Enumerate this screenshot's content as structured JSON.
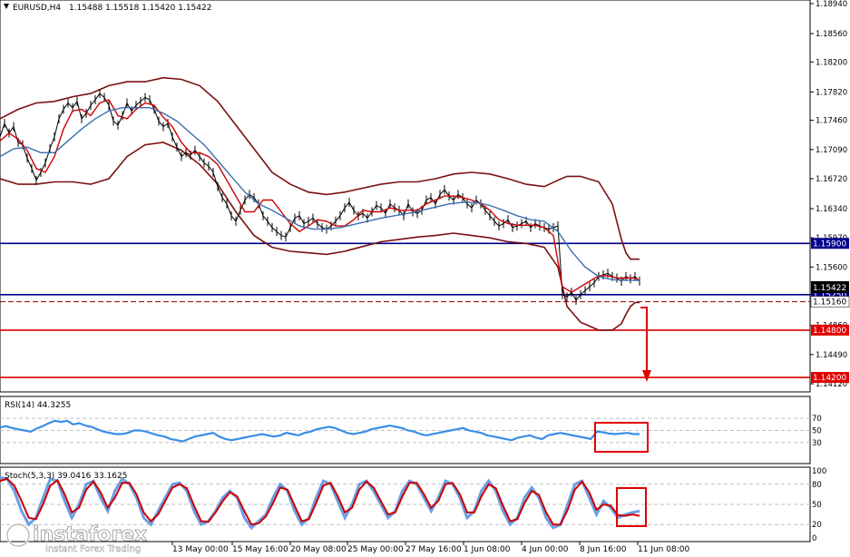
{
  "header": {
    "symbol": "EURUSD,H4",
    "ohlc": "1.15488 1.15518 1.15420 1.15422"
  },
  "rsi": {
    "label": "RSI(14) 44.3255",
    "ticks": [
      "70",
      "50",
      "30"
    ]
  },
  "stoch": {
    "label": "Stoch(5,3,3) 39.0416 33.1625",
    "ticks": [
      "100",
      "80",
      "50",
      "20",
      "0"
    ]
  },
  "logo": {
    "brand": "instaforex",
    "tagline": "Instant Forex Trading"
  },
  "chart_data": {
    "type": "line",
    "title": "EURUSD,H4",
    "y_ticks": [
      "1.18940",
      "1.18560",
      "1.18200",
      "1.17820",
      "1.17460",
      "1.17090",
      "1.16720",
      "1.16340",
      "1.15970",
      "1.15600",
      "1.15250",
      "1.14860",
      "1.14490",
      "1.14120"
    ],
    "x_labels": [
      "13 May 00:00",
      "15 May 16:00",
      "20 May 08:00",
      "25 May 00:00",
      "27 May 16:00",
      "1 Jun 08:00",
      "4 Jun 00:00",
      "8 Jun 16:00",
      "11 Jun 08:00"
    ],
    "current_price": "1.15422",
    "levels": [
      {
        "value": 1.159,
        "label": "1.15900",
        "color": "#00008b"
      },
      {
        "value": 1.1525,
        "label": "1.15250",
        "color": "#00008b"
      },
      {
        "value": 1.1516,
        "label": "1.15160",
        "color": "#8b0000"
      },
      {
        "value": 1.148,
        "label": "1.14800",
        "color": "#e00000"
      },
      {
        "value": 1.142,
        "label": "1.14200",
        "color": "#e00000"
      }
    ],
    "series": [
      {
        "name": "Price",
        "color": "#000000",
        "x": [
          0,
          5,
          10,
          15,
          20,
          25,
          30,
          35,
          40,
          45,
          50,
          55,
          60,
          65,
          70,
          75,
          80,
          85,
          90,
          95,
          100,
          105,
          110,
          115,
          120,
          125,
          130,
          135,
          140,
          145,
          150,
          155,
          160,
          165,
          170,
          175,
          180,
          185,
          190,
          195,
          200,
          205,
          210,
          215,
          220,
          225,
          230,
          235,
          240,
          245,
          250,
          255,
          260,
          265,
          270,
          275,
          280,
          285,
          290,
          295,
          300,
          305,
          310,
          315,
          320,
          325,
          330,
          335,
          340,
          345,
          350,
          355,
          360,
          365,
          370,
          375,
          380,
          385,
          390,
          395,
          400,
          405,
          410,
          415,
          420,
          425,
          430,
          435,
          440,
          445,
          450,
          455,
          460,
          465,
          470,
          475,
          480,
          485,
          490,
          495,
          500,
          505,
          510,
          515,
          520,
          525,
          530,
          535,
          540,
          545,
          550,
          555,
          560,
          565,
          570,
          575,
          580,
          585,
          590,
          595,
          600,
          605,
          610,
          615,
          620,
          625,
          630,
          635,
          640,
          645,
          650,
          655,
          660,
          665,
          670,
          675,
          680,
          685,
          690,
          695,
          700,
          705
        ],
        "values": [
          1.1725,
          1.1742,
          1.173,
          1.1738,
          1.1718,
          1.1715,
          1.1698,
          1.1685,
          1.167,
          1.168,
          1.1692,
          1.171,
          1.1725,
          1.1748,
          1.176,
          1.1768,
          1.1762,
          1.177,
          1.1748,
          1.1755,
          1.1765,
          1.1772,
          1.178,
          1.1775,
          1.1765,
          1.1745,
          1.174,
          1.1752,
          1.1768,
          1.1758,
          1.1765,
          1.177,
          1.1775,
          1.1772,
          1.176,
          1.1745,
          1.1738,
          1.1742,
          1.1725,
          1.1712,
          1.17,
          1.1705,
          1.1702,
          1.1708,
          1.17,
          1.1692,
          1.1688,
          1.168,
          1.1662,
          1.1648,
          1.164,
          1.1625,
          1.1618,
          1.1632,
          1.1645,
          1.1652,
          1.1648,
          1.164,
          1.1625,
          1.1618,
          1.161,
          1.1605,
          1.16,
          1.1598,
          1.161,
          1.1622,
          1.1625,
          1.1615,
          1.1618,
          1.1622,
          1.1615,
          1.161,
          1.1608,
          1.1612,
          1.1618,
          1.1625,
          1.1635,
          1.1642,
          1.1632,
          1.1625,
          1.1628,
          1.1622,
          1.163,
          1.1638,
          1.1635,
          1.1628,
          1.164,
          1.1635,
          1.1632,
          1.1625,
          1.164,
          1.163,
          1.1628,
          1.1632,
          1.1645,
          1.1648,
          1.164,
          1.1652,
          1.1658,
          1.165,
          1.1645,
          1.1652,
          1.1648,
          1.164,
          1.1635,
          1.1645,
          1.164,
          1.1632,
          1.1625,
          1.1618,
          1.1612,
          1.1615,
          1.162,
          1.161,
          1.1612,
          1.1615,
          1.1618,
          1.161,
          1.1615,
          1.1612,
          1.161,
          1.1608,
          1.161,
          1.1612,
          1.1525,
          1.1522,
          1.1528,
          1.1518,
          1.1525,
          1.153,
          1.1535,
          1.154,
          1.1548,
          1.155,
          1.1552,
          1.1548,
          1.1546,
          1.1542,
          1.1548,
          1.1545,
          1.1548,
          1.15422
        ]
      },
      {
        "name": "MA fast",
        "color": "#cc0000",
        "x": [
          0,
          10,
          20,
          30,
          40,
          50,
          60,
          70,
          80,
          90,
          100,
          110,
          120,
          130,
          140,
          150,
          160,
          170,
          180,
          190,
          200,
          210,
          220,
          230,
          240,
          250,
          260,
          270,
          280,
          290,
          300,
          310,
          320,
          330,
          340,
          350,
          360,
          370,
          380,
          390,
          400,
          410,
          420,
          430,
          440,
          450,
          460,
          470,
          480,
          490,
          500,
          510,
          520,
          530,
          540,
          550,
          560,
          570,
          580,
          590,
          600,
          610,
          620,
          630,
          640,
          650,
          660,
          670,
          680,
          690,
          700,
          705
        ],
        "values": [
          1.172,
          1.173,
          1.1722,
          1.1708,
          1.1685,
          1.168,
          1.17,
          1.1735,
          1.1758,
          1.176,
          1.1752,
          1.1768,
          1.1772,
          1.1752,
          1.1748,
          1.176,
          1.1768,
          1.1765,
          1.175,
          1.1738,
          1.1718,
          1.1705,
          1.1705,
          1.17,
          1.169,
          1.167,
          1.165,
          1.163,
          1.163,
          1.1645,
          1.1645,
          1.163,
          1.1615,
          1.1605,
          1.1612,
          1.162,
          1.1618,
          1.1612,
          1.1612,
          1.162,
          1.1632,
          1.163,
          1.163,
          1.1635,
          1.1632,
          1.1632,
          1.1632,
          1.164,
          1.1645,
          1.165,
          1.165,
          1.1648,
          1.1645,
          1.164,
          1.1632,
          1.162,
          1.1615,
          1.1613,
          1.1613,
          1.1613,
          1.161,
          1.16,
          1.1535,
          1.1528,
          1.1535,
          1.1542,
          1.1549,
          1.1549,
          1.1546,
          1.1546,
          1.1546,
          1.1543
        ]
      },
      {
        "name": "MA slow",
        "color": "#3a6fb0",
        "x": [
          0,
          15,
          30,
          45,
          60,
          75,
          90,
          105,
          120,
          135,
          150,
          165,
          180,
          195,
          210,
          225,
          240,
          255,
          270,
          285,
          300,
          315,
          330,
          345,
          360,
          375,
          390,
          405,
          420,
          435,
          450,
          465,
          480,
          495,
          510,
          525,
          540,
          555,
          570,
          585,
          600,
          615,
          630,
          645,
          660,
          675,
          690,
          705
        ],
        "values": [
          1.17,
          1.171,
          1.1712,
          1.1705,
          1.1705,
          1.172,
          1.1735,
          1.1748,
          1.1758,
          1.1762,
          1.1762,
          1.1762,
          1.1755,
          1.1745,
          1.173,
          1.1715,
          1.1695,
          1.1675,
          1.1655,
          1.164,
          1.1632,
          1.1622,
          1.1612,
          1.1608,
          1.1608,
          1.161,
          1.1614,
          1.1618,
          1.1622,
          1.1625,
          1.1628,
          1.1632,
          1.1636,
          1.164,
          1.1642,
          1.1642,
          1.1638,
          1.1632,
          1.1625,
          1.162,
          1.1618,
          1.1605,
          1.158,
          1.156,
          1.1548,
          1.1544,
          1.1543,
          1.1543
        ]
      },
      {
        "name": "BB upper",
        "color": "#7a1010",
        "x": [
          0,
          20,
          40,
          60,
          80,
          100,
          120,
          140,
          160,
          180,
          200,
          220,
          240,
          260,
          280,
          300,
          320,
          340,
          360,
          380,
          400,
          420,
          440,
          460,
          480,
          500,
          520,
          540,
          560,
          580,
          600,
          615,
          625,
          640,
          660,
          675,
          685,
          690,
          695,
          700,
          705
        ],
        "values": [
          1.1748,
          1.176,
          1.1768,
          1.177,
          1.1776,
          1.178,
          1.179,
          1.1795,
          1.1795,
          1.18,
          1.1798,
          1.179,
          1.177,
          1.174,
          1.171,
          1.168,
          1.1665,
          1.1655,
          1.1652,
          1.1655,
          1.166,
          1.1665,
          1.1668,
          1.1668,
          1.1672,
          1.1678,
          1.168,
          1.1678,
          1.1672,
          1.1665,
          1.1662,
          1.167,
          1.1675,
          1.1675,
          1.1668,
          1.164,
          1.1595,
          1.1578,
          1.157,
          1.157,
          1.157
        ]
      },
      {
        "name": "BB lower",
        "color": "#7a1010",
        "x": [
          0,
          20,
          40,
          60,
          80,
          100,
          120,
          140,
          160,
          180,
          200,
          220,
          240,
          260,
          280,
          300,
          320,
          340,
          360,
          380,
          400,
          420,
          440,
          460,
          480,
          500,
          520,
          540,
          560,
          580,
          600,
          615,
          625,
          640,
          660,
          675,
          685,
          690,
          695,
          700,
          705
        ],
        "values": [
          1.1672,
          1.1665,
          1.1665,
          1.1668,
          1.1668,
          1.1665,
          1.1672,
          1.17,
          1.1715,
          1.1718,
          1.1708,
          1.169,
          1.1665,
          1.163,
          1.16,
          1.1585,
          1.158,
          1.1578,
          1.1576,
          1.158,
          1.1586,
          1.1592,
          1.1595,
          1.1598,
          1.16,
          1.1603,
          1.16,
          1.1597,
          1.1592,
          1.159,
          1.1585,
          1.156,
          1.151,
          1.149,
          1.148,
          1.148,
          1.1488,
          1.15,
          1.151,
          1.1515,
          1.1515
        ]
      }
    ],
    "rsi_series": [
      55,
      57,
      54,
      52,
      50,
      48,
      53,
      57,
      62,
      66,
      64,
      66,
      60,
      62,
      58,
      56,
      52,
      48,
      46,
      44,
      44,
      46,
      50,
      50,
      48,
      45,
      42,
      40,
      36,
      34,
      32,
      36,
      40,
      42,
      44,
      46,
      40,
      36,
      34,
      36,
      38,
      40,
      42,
      44,
      42,
      40,
      42,
      46,
      44,
      42,
      46,
      48,
      52,
      54,
      56,
      54,
      50,
      46,
      44,
      46,
      48,
      52,
      54,
      56,
      58,
      56,
      54,
      50,
      48,
      44,
      42,
      44,
      46,
      48,
      50,
      52,
      54,
      50,
      48,
      46,
      42,
      40,
      38,
      36,
      34,
      38,
      40,
      42,
      38,
      36,
      42,
      44,
      46,
      44,
      42,
      40,
      38,
      36,
      48,
      47,
      45,
      44,
      45,
      46,
      44,
      44
    ],
    "stoch_series": {
      "main": [
        90,
        88,
        70,
        40,
        20,
        30,
        60,
        88,
        85,
        55,
        30,
        50,
        80,
        85,
        60,
        40,
        70,
        88,
        80,
        60,
        30,
        20,
        40,
        60,
        80,
        82,
        70,
        40,
        20,
        25,
        40,
        60,
        70,
        60,
        30,
        15,
        25,
        35,
        60,
        80,
        70,
        40,
        20,
        30,
        60,
        85,
        80,
        55,
        30,
        50,
        80,
        85,
        70,
        50,
        30,
        40,
        70,
        85,
        80,
        60,
        40,
        60,
        85,
        80,
        60,
        30,
        40,
        70,
        85,
        70,
        40,
        20,
        30,
        60,
        75,
        60,
        30,
        15,
        20,
        50,
        80,
        85,
        60,
        35,
        55,
        45,
        30,
        35,
        38,
        40
      ],
      "signal": [
        85,
        88,
        78,
        55,
        30,
        28,
        50,
        78,
        86,
        65,
        38,
        45,
        72,
        84,
        68,
        45,
        60,
        82,
        82,
        65,
        38,
        25,
        35,
        55,
        75,
        80,
        74,
        48,
        25,
        24,
        38,
        55,
        68,
        62,
        40,
        20,
        22,
        32,
        52,
        75,
        72,
        48,
        25,
        28,
        52,
        78,
        82,
        62,
        38,
        45,
        72,
        84,
        75,
        55,
        35,
        38,
        62,
        82,
        82,
        65,
        45,
        55,
        80,
        82,
        65,
        38,
        38,
        62,
        80,
        74,
        48,
        25,
        28,
        52,
        70,
        64,
        38,
        20,
        20,
        42,
        72,
        84,
        68,
        42,
        50,
        48,
        34,
        33,
        35,
        33
      ]
    }
  }
}
